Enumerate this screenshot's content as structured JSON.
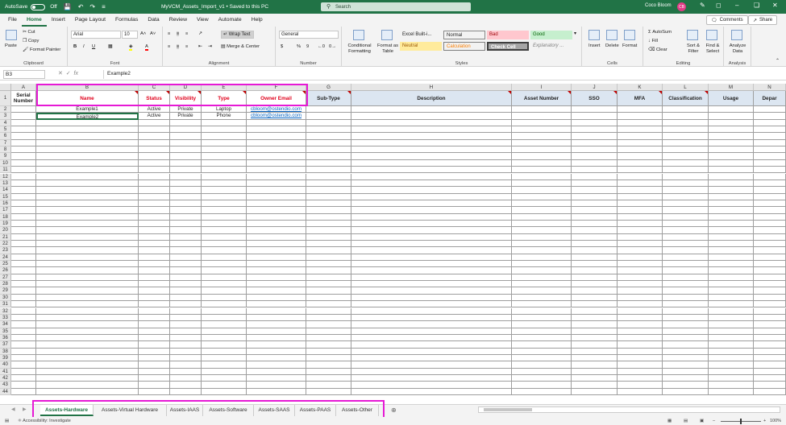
{
  "titlebar": {
    "autosave": "AutoSave",
    "autosave_state": "Off",
    "filename": "MyVCM_Assets_Import_v1",
    "saved": "Saved to this PC",
    "search_placeholder": "Search",
    "user": "Coco Bloom",
    "initials": "CB"
  },
  "menu": [
    "File",
    "Home",
    "Insert",
    "Page Layout",
    "Formulas",
    "Data",
    "Review",
    "View",
    "Automate",
    "Help"
  ],
  "menu_active": "Home",
  "comments": "Comments",
  "share": "Share",
  "ribbon": {
    "clipboard": {
      "label": "Clipboard",
      "paste": "Paste",
      "cut": "Cut",
      "copy": "Copy",
      "format_painter": "Format Painter"
    },
    "font": {
      "label": "Font",
      "family": "Arial",
      "size": "10",
      "bold": "B",
      "italic": "I",
      "underline": "U"
    },
    "alignment": {
      "label": "Alignment",
      "wrap": "Wrap Text",
      "merge": "Merge & Center"
    },
    "number": {
      "label": "Number",
      "format": "General",
      "currency": "$",
      "percent": "%",
      "comma": "9"
    },
    "styles": {
      "label": "Styles",
      "cond": "Conditional Formatting",
      "fmt_table": "Format as Table",
      "items": [
        {
          "label": "Excel Built-i...",
          "bg": "#ffffff",
          "fg": "#000000"
        },
        {
          "label": "Normal",
          "bg": "#ffffff",
          "fg": "#000000"
        },
        {
          "label": "Bad",
          "bg": "#ffc7ce",
          "fg": "#9c0006"
        },
        {
          "label": "Good",
          "bg": "#c6efce",
          "fg": "#006100"
        },
        {
          "label": "Neutral",
          "bg": "#ffeb9c",
          "fg": "#9c5700"
        },
        {
          "label": "Calculation",
          "bg": "#f2f2f2",
          "fg": "#fa7d00"
        },
        {
          "label": "Check Cell",
          "bg": "#a5a5a5",
          "fg": "#ffffff"
        },
        {
          "label": "Explanatory ...",
          "bg": "#ffffff",
          "fg": "#7f7f7f"
        }
      ]
    },
    "cells": {
      "label": "Cells",
      "insert": "Insert",
      "delete": "Delete",
      "format": "Format"
    },
    "editing": {
      "label": "Editing",
      "autosum": "AutoSum",
      "fill": "Fill",
      "clear": "Clear",
      "sort": "Sort & Filter",
      "find": "Find & Select"
    },
    "analysis": {
      "label": "Analysis",
      "analyze": "Analyze Data"
    }
  },
  "namebox": "B3",
  "fx": "fx",
  "formula": "Example2",
  "columns": [
    "A",
    "B",
    "C",
    "D",
    "E",
    "F",
    "G",
    "H",
    "I",
    "J",
    "K",
    "L",
    "M",
    "N"
  ],
  "headers": [
    "Serial Number",
    "Name",
    "Status",
    "Visibility",
    "Type",
    "Owner Email",
    "Sub-Type",
    "Description",
    "Asset Number",
    "SSO",
    "MFA",
    "Classification",
    "Usage",
    "Depar"
  ],
  "rows": [
    [
      "",
      "Example1",
      "Active",
      "Private",
      "Laptop",
      "cbloom@ostendio.com"
    ],
    [
      "",
      "Example2",
      "Active",
      "Private",
      "Phone",
      "cbloom@ostendio.com"
    ]
  ],
  "row_count": 44,
  "sheets": [
    "Assets-Hardware",
    "Assets-Virtual Hardware",
    "Assets-IAAS",
    "Assets-Software",
    "Assets-SAAS",
    "Assets-PAAS",
    "Assets-Other"
  ],
  "active_sheet": "Assets-Hardware",
  "status": {
    "accessibility": "Accessibility: Investigate",
    "zoom": "100%"
  },
  "colors": {
    "accent": "#217346",
    "required": "#e0001b",
    "highlight": "#e619d5",
    "header_fill": "#dce6f1"
  }
}
